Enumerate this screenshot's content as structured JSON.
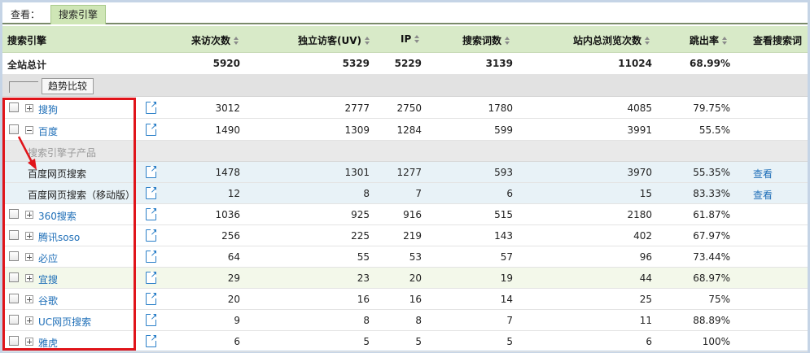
{
  "topbar": {
    "view_label": "查看：",
    "active_tab": "搜索引擎"
  },
  "columns": [
    {
      "label": "搜索引擎",
      "sortable": false
    },
    {
      "label": "来访次数",
      "sortable": true
    },
    {
      "label": "独立访客(UV)",
      "sortable": true
    },
    {
      "label": "IP",
      "sortable": true
    },
    {
      "label": "搜索词数",
      "sortable": true
    },
    {
      "label": "站内总浏览次数",
      "sortable": true
    },
    {
      "label": "跳出率",
      "sortable": true
    },
    {
      "label": "查看搜索词",
      "sortable": false
    }
  ],
  "total": {
    "name": "全站总计",
    "visits": "5920",
    "uv": "5329",
    "ip": "5229",
    "keywords": "3139",
    "pageviews": "11024",
    "bounce": "68.99%"
  },
  "trend_button": "趋势比较",
  "rows": [
    {
      "name": "搜狗",
      "visits": "3012",
      "uv": "2777",
      "ip": "2750",
      "keywords": "1780",
      "pageviews": "4085",
      "bounce": "79.75%",
      "expanded": false
    },
    {
      "name": "百度",
      "visits": "1490",
      "uv": "1309",
      "ip": "1284",
      "keywords": "599",
      "pageviews": "3991",
      "bounce": "55.5%",
      "expanded": true
    }
  ],
  "sub_header": "搜索引擎子产品",
  "sub_rows": [
    {
      "name": "百度网页搜索",
      "visits": "1478",
      "uv": "1301",
      "ip": "1277",
      "keywords": "593",
      "pageviews": "3970",
      "bounce": "55.35%",
      "view": "查看"
    },
    {
      "name": "百度网页搜索（移动版）",
      "visits": "12",
      "uv": "8",
      "ip": "7",
      "keywords": "6",
      "pageviews": "15",
      "bounce": "83.33%",
      "view": "查看"
    }
  ],
  "rows2": [
    {
      "name": "360搜索",
      "visits": "1036",
      "uv": "925",
      "ip": "916",
      "keywords": "515",
      "pageviews": "2180",
      "bounce": "61.87%"
    },
    {
      "name": "腾讯soso",
      "visits": "256",
      "uv": "225",
      "ip": "219",
      "keywords": "143",
      "pageviews": "402",
      "bounce": "67.97%"
    },
    {
      "name": "必应",
      "visits": "64",
      "uv": "55",
      "ip": "53",
      "keywords": "57",
      "pageviews": "96",
      "bounce": "73.44%"
    },
    {
      "name": "宜搜",
      "visits": "29",
      "uv": "23",
      "ip": "20",
      "keywords": "19",
      "pageviews": "44",
      "bounce": "68.97%"
    },
    {
      "name": "谷歌",
      "visits": "20",
      "uv": "16",
      "ip": "16",
      "keywords": "14",
      "pageviews": "25",
      "bounce": "75%"
    },
    {
      "name": "UC网页搜索",
      "visits": "9",
      "uv": "8",
      "ip": "8",
      "keywords": "7",
      "pageviews": "11",
      "bounce": "88.89%"
    },
    {
      "name": "雅虎",
      "visits": "6",
      "uv": "5",
      "ip": "5",
      "keywords": "5",
      "pageviews": "6",
      "bounce": "100%"
    }
  ],
  "colors": {
    "header_bg": "#d8eac8",
    "tab_bg": "#cfe6b6",
    "link": "#1f6fb8",
    "highlight": "#e0141a"
  }
}
